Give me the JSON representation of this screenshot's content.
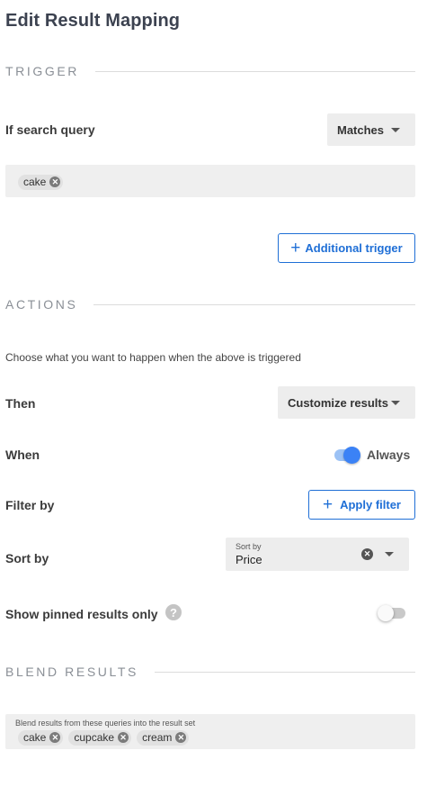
{
  "page": {
    "title": "Edit Result Mapping"
  },
  "trigger": {
    "section_label": "TRIGGER",
    "condition_label": "If search query",
    "match_select": "Matches",
    "chips": [
      "cake"
    ],
    "additional_trigger_label": "Additional trigger"
  },
  "actions": {
    "section_label": "ACTIONS",
    "description": "Choose what you want to happen when the above is triggered",
    "then_label": "Then",
    "then_select": "Customize results",
    "when_label": "When",
    "when_toggle_label": "Always",
    "when_toggle_on": true,
    "filter_label": "Filter by",
    "apply_filter_label": "Apply filter",
    "sort_label": "Sort by",
    "sort_field_caption": "Sort by",
    "sort_value": "Price",
    "pinned_label": "Show pinned results only",
    "pinned_toggle_on": false
  },
  "blend": {
    "section_label": "BLEND RESULTS",
    "field_caption": "Blend results from these queries into the result set",
    "chips": [
      "cake",
      "cupcake",
      "cream"
    ]
  },
  "colors": {
    "accent": "#1f6fd6",
    "toggle_on": "#3b82f6"
  }
}
